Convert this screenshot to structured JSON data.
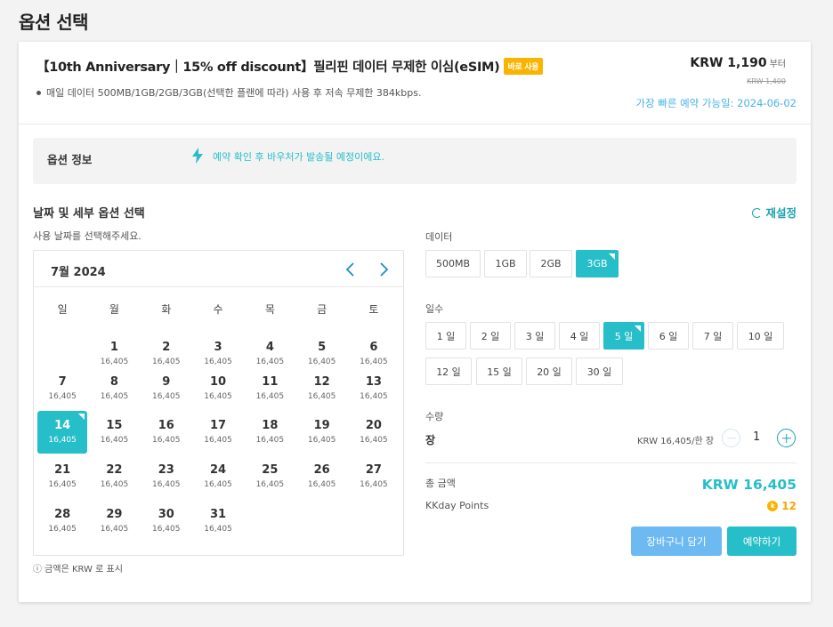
{
  "page": {
    "title": "옵션 선택"
  },
  "product": {
    "title": "【10th Anniversary｜15% off discount】필리핀 데이터 무제한 이심(eSIM)",
    "badge": "바로 사용",
    "description": "매일 데이터 500MB/1GB/2GB/3GB(선택한 플랜에 따라) 사용 후 저속 무제한 384kbps.",
    "price": "KRW 1,190",
    "price_suffix": "부터",
    "original_price": "KRW 1,400",
    "earliest": "가장 빠른 예약 가능일: 2024-06-02"
  },
  "info": {
    "label": "옵션 정보",
    "text": "예약 확인 후 바우처가 발송될 예정이에요."
  },
  "selection": {
    "title": "날짜 및 세부 옵션 선택",
    "reset": "재설정",
    "date_hint": "사용 날짜를 선택해주세요.",
    "note": "ⓘ 금액은 KRW 로 표시"
  },
  "calendar": {
    "month": "7월 2024",
    "weekdays": [
      "일",
      "월",
      "화",
      "수",
      "목",
      "금",
      "토"
    ],
    "days": [
      {
        "d": "1",
        "p": "16,405"
      },
      {
        "d": "2",
        "p": "16,405"
      },
      {
        "d": "3",
        "p": "16,405"
      },
      {
        "d": "4",
        "p": "16,405"
      },
      {
        "d": "5",
        "p": "16,405"
      },
      {
        "d": "6",
        "p": "16,405"
      },
      {
        "d": "7",
        "p": "16,405"
      },
      {
        "d": "8",
        "p": "16,405"
      },
      {
        "d": "9",
        "p": "16,405"
      },
      {
        "d": "10",
        "p": "16,405"
      },
      {
        "d": "11",
        "p": "16,405"
      },
      {
        "d": "12",
        "p": "16,405"
      },
      {
        "d": "13",
        "p": "16,405"
      },
      {
        "d": "14",
        "p": "16,405",
        "selected": true
      },
      {
        "d": "15",
        "p": "16,405"
      },
      {
        "d": "16",
        "p": "16,405"
      },
      {
        "d": "17",
        "p": "16,405"
      },
      {
        "d": "18",
        "p": "16,405"
      },
      {
        "d": "19",
        "p": "16,405"
      },
      {
        "d": "20",
        "p": "16,405"
      },
      {
        "d": "21",
        "p": "16,405"
      },
      {
        "d": "22",
        "p": "16,405"
      },
      {
        "d": "23",
        "p": "16,405"
      },
      {
        "d": "24",
        "p": "16,405"
      },
      {
        "d": "25",
        "p": "16,405"
      },
      {
        "d": "26",
        "p": "16,405"
      },
      {
        "d": "27",
        "p": "16,405"
      },
      {
        "d": "28",
        "p": "16,405"
      },
      {
        "d": "29",
        "p": "16,405"
      },
      {
        "d": "30",
        "p": "16,405"
      },
      {
        "d": "31",
        "p": "16,405"
      }
    ]
  },
  "data_option": {
    "label": "데이터",
    "options": [
      "500MB",
      "1GB",
      "2GB",
      "3GB"
    ],
    "selected": "3GB"
  },
  "days_option": {
    "label": "일수",
    "options": [
      "1 일",
      "2 일",
      "3 일",
      "4 일",
      "5 일",
      "6 일",
      "7 일",
      "10 일",
      "12 일",
      "15 일",
      "20 일",
      "30 일"
    ],
    "selected": "5 일"
  },
  "quantity": {
    "section_label": "수량",
    "unit_label": "장",
    "unit_price": "KRW 16,405/한 장",
    "value": "1"
  },
  "total": {
    "label": "총 금액",
    "value": "KRW 16,405",
    "points_label": "KKday Points",
    "points_value": "12",
    "points_icon": "k"
  },
  "buttons": {
    "cart": "장바구니 담기",
    "book": "예약하기"
  },
  "colors": {
    "accent": "#26bec9",
    "cart": "#6db9f2",
    "badge": "#f8b400"
  }
}
